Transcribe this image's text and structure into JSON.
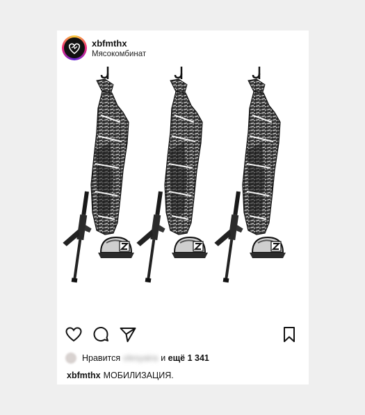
{
  "post": {
    "username": "xbfmthx",
    "location": "Мясокомбинат"
  },
  "actions": {
    "like_icon": "heart-icon",
    "comment_icon": "comment-icon",
    "share_icon": "paper-plane-icon",
    "save_icon": "bookmark-icon"
  },
  "likes": {
    "prefix": "Нравится",
    "liker": "olesyaira",
    "connector": "и",
    "others": "ещё 1 341"
  },
  "caption": {
    "username": "xbfmthx",
    "text": "МОБИЛИЗАЦИЯ."
  },
  "colors": {
    "background": "#efefef",
    "card": "#ffffff",
    "text": "#111111",
    "ring": [
      "#f9ce34",
      "#ee2a7b",
      "#6228d7"
    ]
  }
}
